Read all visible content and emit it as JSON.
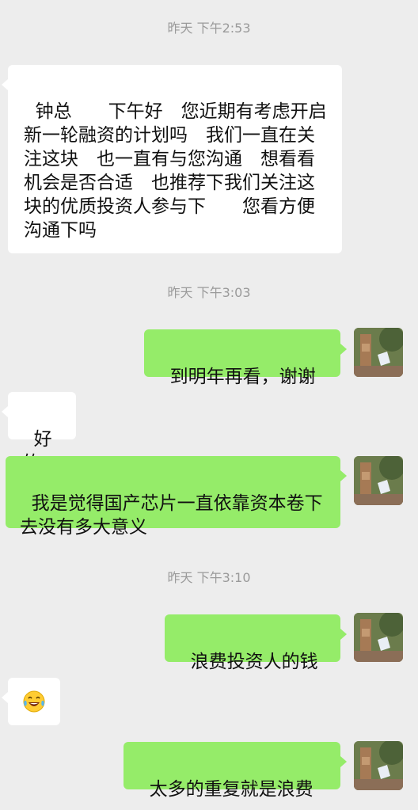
{
  "messages": [
    {
      "type": "timestamp",
      "text": "昨天 下午2:53"
    },
    {
      "type": "incoming",
      "text": "钟总　　下午好　您近期有考虑开启新一轮融资的计划吗　我们一直在关注这块　也一直有与您沟通　想看看机会是否合适　也推荐下我们关注这块的优质投资人参与下　　您看方便沟通下吗"
    },
    {
      "type": "timestamp",
      "text": "昨天 下午3:03"
    },
    {
      "type": "outgoing",
      "text": "到明年再看，谢谢"
    },
    {
      "type": "incoming",
      "text": "好的"
    },
    {
      "type": "outgoing",
      "text": "我是觉得国产芯片一直依靠资本卷下去没有多大意义"
    },
    {
      "type": "timestamp",
      "text": "昨天 下午3:10"
    },
    {
      "type": "outgoing",
      "text": "浪费投资人的钱"
    },
    {
      "type": "incoming",
      "emoji": "laughing-with-tears"
    },
    {
      "type": "outgoing",
      "text": "太多的重复就是浪费"
    }
  ]
}
